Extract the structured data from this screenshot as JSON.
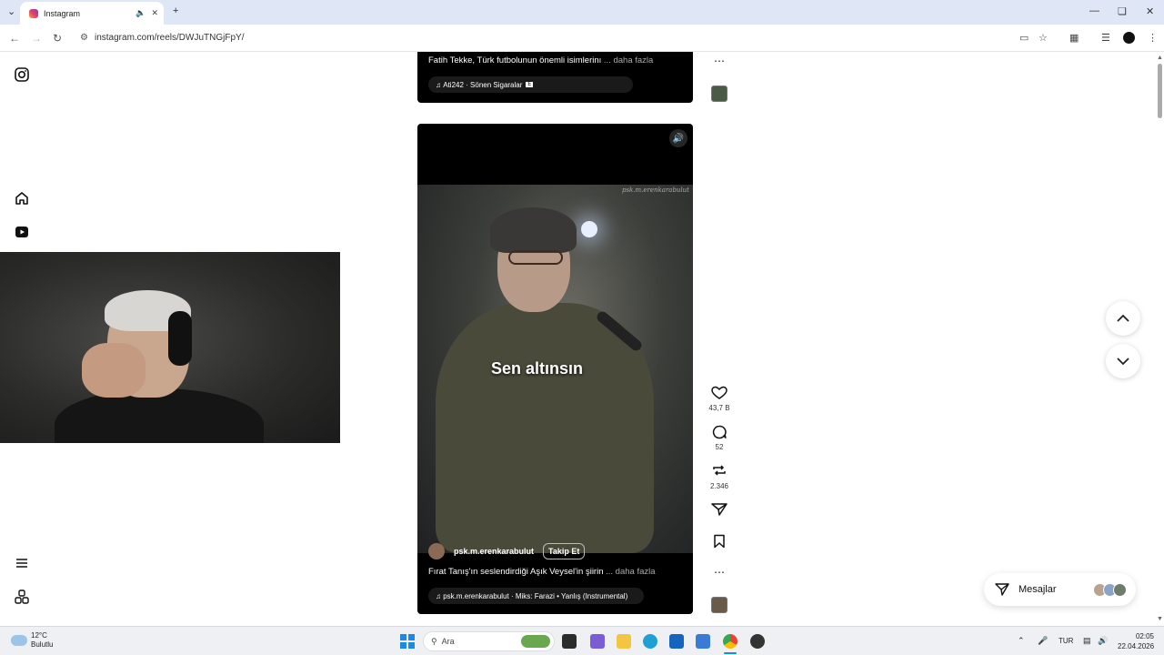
{
  "browser": {
    "tab_title": "Instagram",
    "url": "instagram.com/reels/DWJuTNGjFpY/"
  },
  "reel_prev": {
    "description": "Fatih Tekke, Türk futbolunun önemli isimlerinı",
    "more": "... daha fazla",
    "music": "Ati242 · Sönen Sigaralar"
  },
  "reel": {
    "caption": "Sen altınsın",
    "watermark": "psk.m.erenkarabulut",
    "username": "psk.m.erenkarabulut",
    "follow_label": "Takip Et",
    "description": "Fırat Tanış'ın seslendirdiği Aşık Veysel'in şiirin",
    "more": "... daha fazla",
    "music": "psk.m.erenkarabulut · Miks: Farazi • Yanlış (Instrumental)"
  },
  "actions": {
    "likes": "43,7 B",
    "comments": "52",
    "reposts": "2.346"
  },
  "messages": {
    "label": "Mesajlar"
  },
  "taskbar": {
    "temperature": "12°C",
    "weather": "Bulutlu",
    "search_placeholder": "Ara",
    "lang": "TUR",
    "time": "02:05",
    "date": "22.04.2026"
  },
  "colors": {
    "accent_start": "#1e88e5",
    "tab_bar": "#dfe6f5"
  }
}
